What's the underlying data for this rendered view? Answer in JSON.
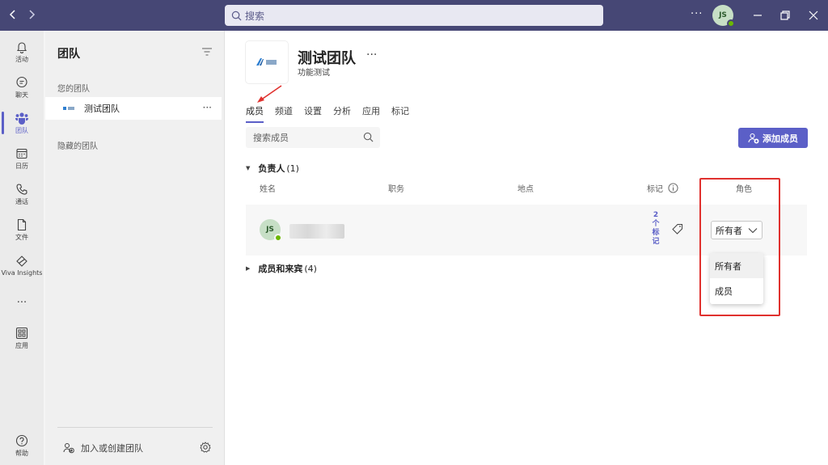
{
  "titlebar": {
    "search_placeholder": "搜索",
    "more": "···",
    "avatar_initials": "JS"
  },
  "rail": [
    {
      "label": "活动",
      "icon": "bell-icon"
    },
    {
      "label": "聊天",
      "icon": "chat-icon"
    },
    {
      "label": "团队",
      "icon": "teams-icon",
      "active": true
    },
    {
      "label": "日历",
      "icon": "calendar-icon"
    },
    {
      "label": "通话",
      "icon": "phone-icon"
    },
    {
      "label": "文件",
      "icon": "file-icon"
    },
    {
      "label": "Viva Insights",
      "icon": "viva-insights-icon"
    },
    {
      "label": "···",
      "icon": "more-icon"
    },
    {
      "label": "应用",
      "icon": "apps-icon"
    },
    {
      "label": "帮助",
      "icon": "help-icon"
    }
  ],
  "panel": {
    "title": "团队",
    "your_teams_label": "您的团队",
    "team_name": "测试团队",
    "team_more": "···",
    "hidden_teams_label": "隐藏的团队",
    "join_create": "加入或创建团队"
  },
  "main": {
    "team_title": "测试团队",
    "team_title_more": "···",
    "team_description": "功能测试",
    "tabs": [
      {
        "label": "成员",
        "active": true
      },
      {
        "label": "频道"
      },
      {
        "label": "设置"
      },
      {
        "label": "分析"
      },
      {
        "label": "应用"
      },
      {
        "label": "标记"
      }
    ],
    "search_placeholder": "搜索成员",
    "add_member_label": "添加成员",
    "owners_group": {
      "label": "负责人",
      "count": "(1)"
    },
    "members_group": {
      "label": "成员和来宾",
      "count": "(4)"
    },
    "columns": {
      "name": "姓名",
      "title": "职务",
      "location": "地点",
      "tags": "标记",
      "role": "角色"
    },
    "member": {
      "initials": "JS",
      "tag_count_lines": [
        "2",
        "个",
        "标",
        "记"
      ],
      "role": "所有者"
    },
    "role_options": [
      "所有者",
      "成员"
    ]
  },
  "colors": {
    "titlebar": "#464775",
    "accent": "#5b5fc7",
    "highlight_box": "#e0312e",
    "presence": "#6bb700"
  }
}
